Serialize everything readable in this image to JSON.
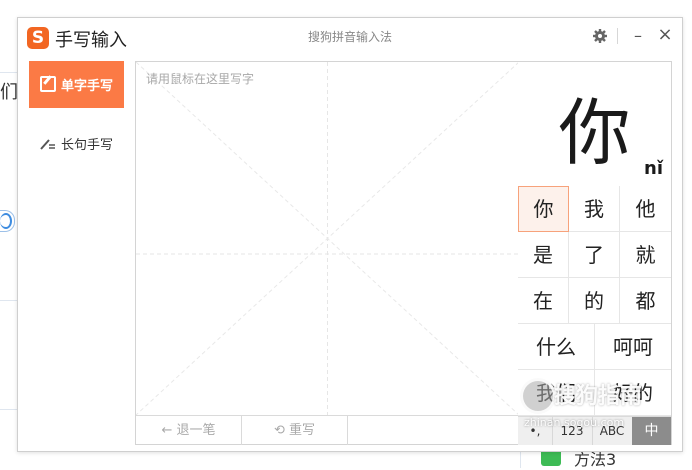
{
  "background": {
    "left_char": "们",
    "bottom_text": "方法3"
  },
  "window": {
    "app_title": "手写输入",
    "subtitle": "搜狗拼音输入法",
    "logo_letter": "S",
    "controls": {
      "settings_icon": "gear-icon",
      "minimize": "–",
      "close": "×"
    }
  },
  "modes": [
    {
      "label": "单字手写",
      "active": true
    },
    {
      "label": "长句手写",
      "active": false
    }
  ],
  "pad": {
    "hint": "请用鼠标在这里写字",
    "undo_label": "← 退一笔",
    "rewrite_label": "⟲ 重写"
  },
  "candidates": {
    "preview_char": "你",
    "preview_pinyin": "nǐ",
    "rows": [
      [
        "你",
        "我",
        "他"
      ],
      [
        "是",
        "了",
        "就"
      ],
      [
        "在",
        "的",
        "都"
      ],
      [
        "什么",
        "呵呵"
      ],
      [
        "我们",
        "好的"
      ]
    ],
    "selected": "你"
  },
  "keyboard": {
    "keys": [
      "•,",
      "123",
      "ABC",
      "中"
    ],
    "active": "中"
  },
  "watermark": {
    "text": "搜狗指南",
    "url": "zhinan.sogou.com"
  },
  "colors": {
    "accent": "#fb7a45",
    "logo": "#f26622",
    "selected_bg": "#fdf1eb"
  }
}
